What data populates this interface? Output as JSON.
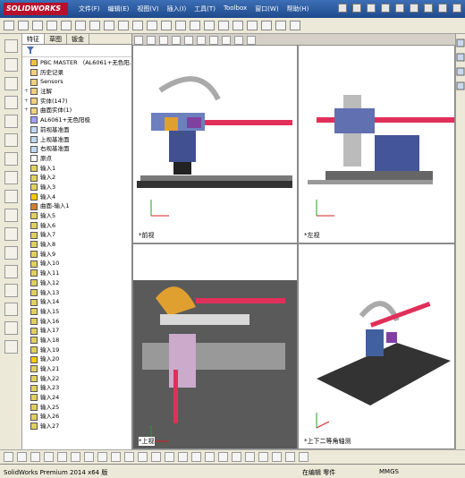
{
  "app": {
    "logo": "SOLIDWORKS"
  },
  "menu": [
    "文件(F)",
    "编辑(E)",
    "视图(V)",
    "插入(I)",
    "工具(T)",
    "Toolbox",
    "窗口(W)",
    "帮助(H)"
  ],
  "tabs": [
    "特征",
    "草图",
    "钣金"
  ],
  "tree": [
    {
      "label": "PBC MASTER （AL6061+无色阳...",
      "type": "root"
    },
    {
      "label": "历史记录",
      "type": "folder"
    },
    {
      "label": "Sensors",
      "type": "folder"
    },
    {
      "label": "注解",
      "type": "folder",
      "exp": "+"
    },
    {
      "label": "实体(147)",
      "type": "folder",
      "exp": "+"
    },
    {
      "label": "曲面实体(1)",
      "type": "folder",
      "exp": "+"
    },
    {
      "label": "AL6061+无色阳极",
      "type": "mat"
    },
    {
      "label": "前视基准面",
      "type": "plane"
    },
    {
      "label": "上视基准面",
      "type": "plane"
    },
    {
      "label": "右视基准面",
      "type": "plane"
    },
    {
      "label": "原点",
      "type": "origin"
    },
    {
      "label": "输入1",
      "type": "import"
    },
    {
      "label": "输入2",
      "type": "import"
    },
    {
      "label": "输入3",
      "type": "import"
    },
    {
      "label": "输入4",
      "type": "warn"
    },
    {
      "label": "曲面-输入1",
      "type": "surf"
    },
    {
      "label": "输入5",
      "type": "import"
    },
    {
      "label": "输入6",
      "type": "import"
    },
    {
      "label": "输入7",
      "type": "import"
    },
    {
      "label": "输入8",
      "type": "import"
    },
    {
      "label": "输入9",
      "type": "import"
    },
    {
      "label": "输入10",
      "type": "import"
    },
    {
      "label": "输入11",
      "type": "import"
    },
    {
      "label": "输入12",
      "type": "import"
    },
    {
      "label": "输入13",
      "type": "import"
    },
    {
      "label": "输入14",
      "type": "import"
    },
    {
      "label": "输入15",
      "type": "import"
    },
    {
      "label": "输入16",
      "type": "import"
    },
    {
      "label": "输入17",
      "type": "import"
    },
    {
      "label": "输入18",
      "type": "import"
    },
    {
      "label": "输入19",
      "type": "import"
    },
    {
      "label": "输入20",
      "type": "warn"
    },
    {
      "label": "输入21",
      "type": "import"
    },
    {
      "label": "输入22",
      "type": "import"
    },
    {
      "label": "输入23",
      "type": "import"
    },
    {
      "label": "输入24",
      "type": "import"
    },
    {
      "label": "输入25",
      "type": "import"
    },
    {
      "label": "输入26",
      "type": "import"
    },
    {
      "label": "输入27",
      "type": "import"
    }
  ],
  "viewports": {
    "front": "*前视",
    "left": "*左视",
    "top": "*上视",
    "iso": "*上下二等角轴测"
  },
  "status": {
    "left": "SolidWorks Premium 2014 x64 版",
    "mid": "在编辑 零件",
    "right": "MMGS"
  },
  "colors": {
    "accent": "#b8102a",
    "rod": "#e0305a",
    "warn": "#ffcc00"
  }
}
